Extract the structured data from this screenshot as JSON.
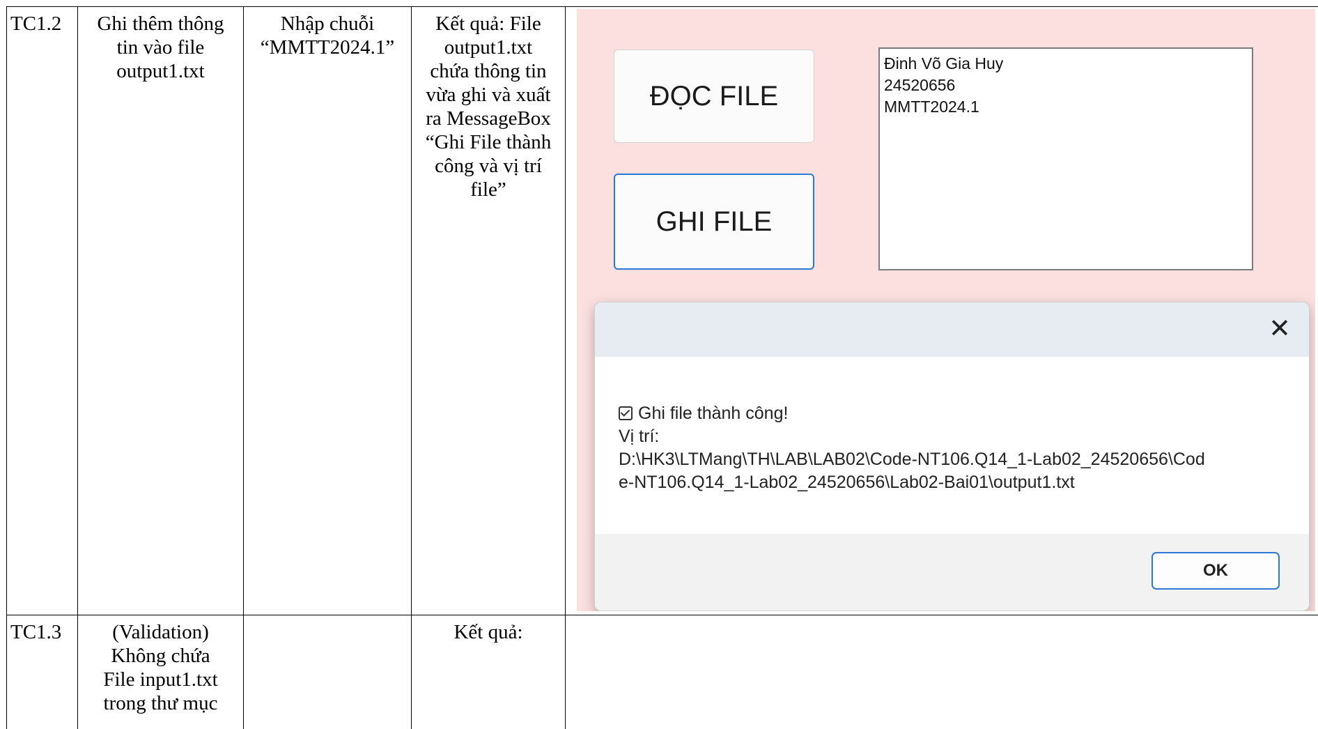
{
  "table": {
    "rows": [
      {
        "id": "TC1.2",
        "description": [
          "Ghi thêm thông",
          "tin vào file",
          "output1.txt"
        ],
        "input": [
          "Nhập chuỗi",
          "“MMTT2024.1”"
        ],
        "expected": [
          "Kết quả: File",
          "output1.txt",
          "chứa thông tin",
          "vừa ghi và xuất",
          "ra MessageBox",
          "“Ghi File thành",
          "công và vị trí",
          "file”"
        ]
      },
      {
        "id": "TC1.3",
        "description": [
          "(Validation)",
          "Không chứa",
          "File input1.txt",
          "trong thư mục"
        ],
        "input": [],
        "expected": [
          "Kết quả:"
        ]
      }
    ]
  },
  "screenshot": {
    "buttons": {
      "read": "ĐỌC FILE",
      "write": "GHI FILE"
    },
    "textbox_lines": [
      "Đinh Võ Gia Huy",
      "24520656",
      "MMTT2024.1"
    ],
    "dialog": {
      "close_symbol": "✕",
      "message_lines": [
        "Ghi file thành công!",
        "Vị trí:",
        "D:\\HK3\\LTMang\\TH\\LAB\\LAB02\\Code-NT106.Q14_1-Lab02_24520656\\Cod",
        "e-NT106.Q14_1-Lab02_24520656\\Lab02-Bai01\\output1.txt"
      ],
      "ok_label": "OK"
    },
    "colors": {
      "form_bg": "#fbe0df",
      "accent": "#2f77d4"
    }
  }
}
